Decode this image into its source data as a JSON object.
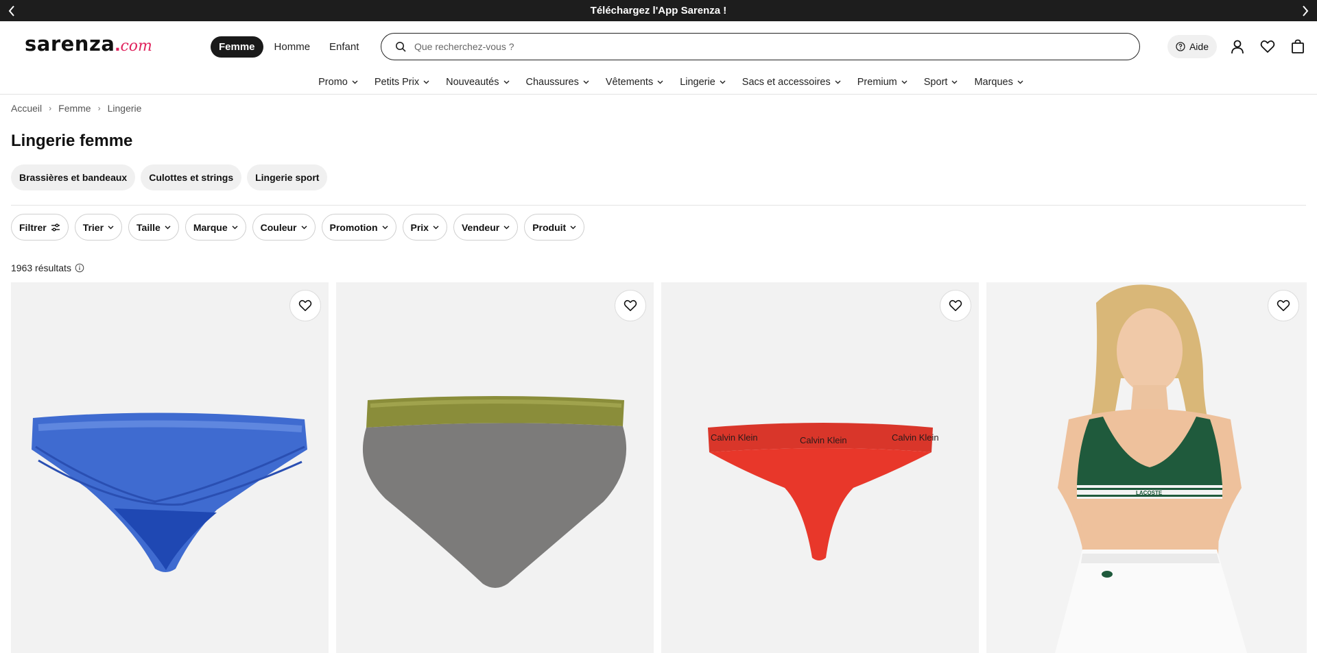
{
  "announcement": {
    "text": "Téléchargez l'App Sarenza !",
    "prev_icon": "chevron-left-icon",
    "next_icon": "chevron-right-icon"
  },
  "header": {
    "logo": {
      "brand": "sarenza",
      "dot": ".",
      "suffix": "com"
    },
    "gender_tabs": [
      {
        "label": "Femme",
        "active": true
      },
      {
        "label": "Homme",
        "active": false
      },
      {
        "label": "Enfant",
        "active": false
      }
    ],
    "search": {
      "placeholder": "Que recherchez-vous ?",
      "value": ""
    },
    "help_label": "Aide",
    "icons": [
      "help-circle-icon",
      "user-icon",
      "heart-icon",
      "shopping-bag-icon"
    ]
  },
  "nav": {
    "items": [
      {
        "label": "Promo"
      },
      {
        "label": "Petits Prix"
      },
      {
        "label": "Nouveautés"
      },
      {
        "label": "Chaussures"
      },
      {
        "label": "Vêtements"
      },
      {
        "label": "Lingerie"
      },
      {
        "label": "Sacs et accessoires"
      },
      {
        "label": "Premium"
      },
      {
        "label": "Sport"
      },
      {
        "label": "Marques"
      }
    ]
  },
  "breadcrumb": [
    "Accueil",
    "Femme",
    "Lingerie"
  ],
  "page": {
    "title": "Lingerie femme",
    "subcategories": [
      "Brassières et bandeaux",
      "Culottes et strings",
      "Lingerie sport"
    ],
    "filters": [
      "Filtrer",
      "Trier",
      "Taille",
      "Marque",
      "Couleur",
      "Promotion",
      "Prix",
      "Vendeur",
      "Produit"
    ],
    "results_text": "1963 résultats"
  },
  "products": [
    {
      "kind": "blue-mesh-brief",
      "color": "#2f5fc9"
    },
    {
      "kind": "grey-brief-khaki-waistband",
      "color": "#7c7b7a",
      "band_color": "#8a8d3a"
    },
    {
      "kind": "red-thong",
      "color": "#e8372a",
      "band_text": "Calvin Klein"
    },
    {
      "kind": "model-green-sports-bra",
      "color": "#1f5a3c",
      "band_text": "LACOSTE"
    }
  ],
  "colors": {
    "topbar": "#1d1d1d",
    "accent": "#e0245e"
  }
}
